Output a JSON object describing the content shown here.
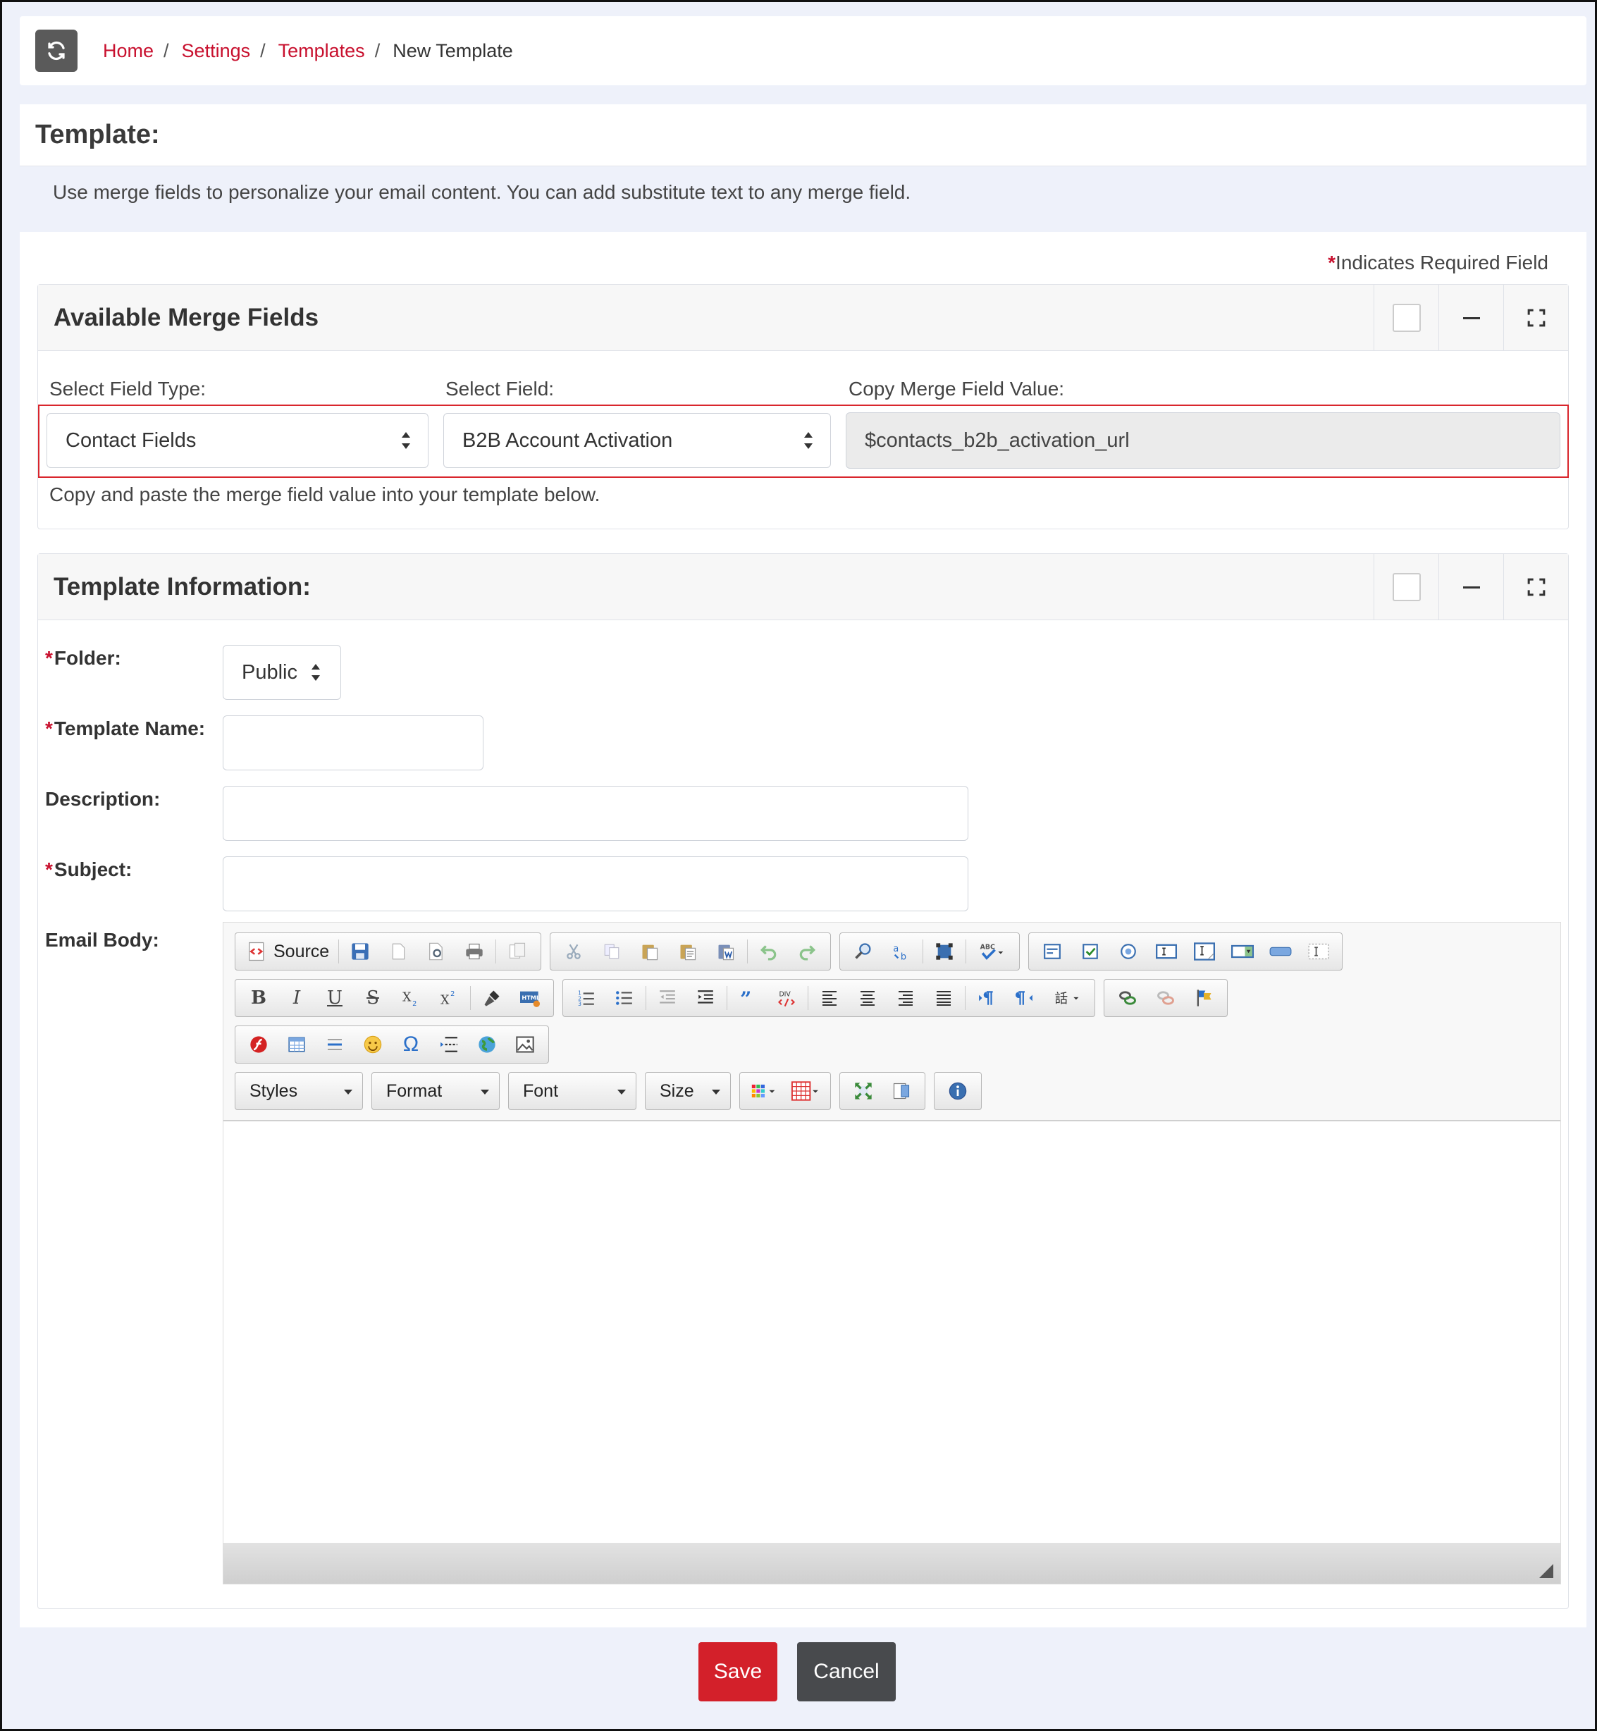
{
  "breadcrumb": {
    "items": [
      {
        "label": "Home"
      },
      {
        "label": "Settings"
      },
      {
        "label": "Templates"
      }
    ],
    "current": "New Template"
  },
  "page": {
    "title": "Template:",
    "intro": "Use merge fields to personalize your email content. You can add substitute text to any merge field.",
    "required_note": "Indicates Required Field",
    "required_mark": "*"
  },
  "merge_panel": {
    "title": "Available Merge Fields",
    "field_type_label": "Select Field Type:",
    "field_type_value": "Contact Fields",
    "field_label": "Select Field:",
    "field_value": "B2B Account Activation",
    "copy_label": "Copy Merge Field Value:",
    "copy_value": "$contacts_b2b_activation_url",
    "help": "Copy and paste the merge field value into your template below."
  },
  "template_panel": {
    "title": "Template Information:",
    "folder_label": "Folder:",
    "folder_value": "Public",
    "name_label": "Template Name:",
    "description_label": "Description:",
    "subject_label": "Subject:",
    "body_label": "Email Body:"
  },
  "editor": {
    "source_label": "Source",
    "combos": {
      "styles": "Styles",
      "format": "Format",
      "font": "Font",
      "size": "Size"
    },
    "bold": "B",
    "italic": "I",
    "underline": "U",
    "strike": "S",
    "omega": "Ω"
  },
  "actions": {
    "save": "Save",
    "cancel": "Cancel"
  },
  "colors": {
    "accent": "#c8102e",
    "save": "#d3202a",
    "cancel": "#484a4d",
    "background": "#eef1fa",
    "highlight": "#d9262d"
  }
}
